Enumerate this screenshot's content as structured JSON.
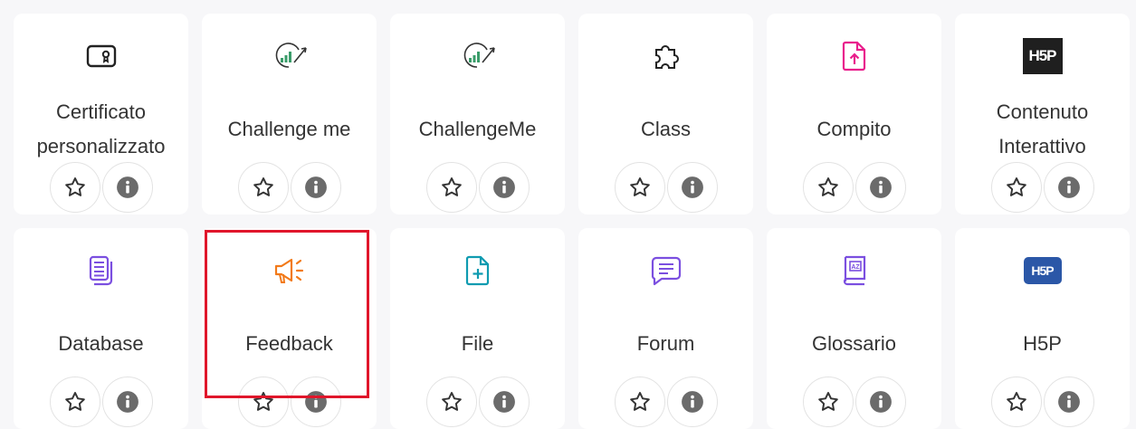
{
  "colors": {
    "highlight": "#e0162b",
    "accent_pink": "#e91e8c",
    "accent_purple": "#7b4fe0",
    "accent_orange": "#f27a1a",
    "accent_teal": "#0f9bb0",
    "h5p_blue": "#2b57a7"
  },
  "modules": [
    {
      "name_lines": [
        "Certificato",
        "personalizzato"
      ],
      "icon": "certificate-icon"
    },
    {
      "name_lines": [
        "Challenge me"
      ],
      "icon": "challenge-chart-icon"
    },
    {
      "name_lines": [
        "ChallengeMe"
      ],
      "icon": "challenge-chart-icon"
    },
    {
      "name_lines": [
        "Class"
      ],
      "icon": "puzzle-icon"
    },
    {
      "name_lines": [
        "Compito"
      ],
      "icon": "file-upload-icon"
    },
    {
      "name_lines": [
        "Contenuto",
        "Interattivo"
      ],
      "icon": "h5p-logo-icon",
      "logo_text": "H5P"
    },
    {
      "name_lines": [
        "Database"
      ],
      "icon": "database-icon"
    },
    {
      "name_lines": [
        "Feedback"
      ],
      "icon": "megaphone-icon",
      "highlighted": true
    },
    {
      "name_lines": [
        "File"
      ],
      "icon": "file-add-icon"
    },
    {
      "name_lines": [
        "Forum"
      ],
      "icon": "chat-icon"
    },
    {
      "name_lines": [
        "Glossario"
      ],
      "icon": "glossary-book-icon",
      "icon_text": "AZ"
    },
    {
      "name_lines": [
        "H5P"
      ],
      "icon": "h5p-badge-icon",
      "logo_text": "H5P"
    }
  ],
  "actions": {
    "star_icon": "star-outline-icon",
    "info_icon": "info-circle-icon"
  }
}
